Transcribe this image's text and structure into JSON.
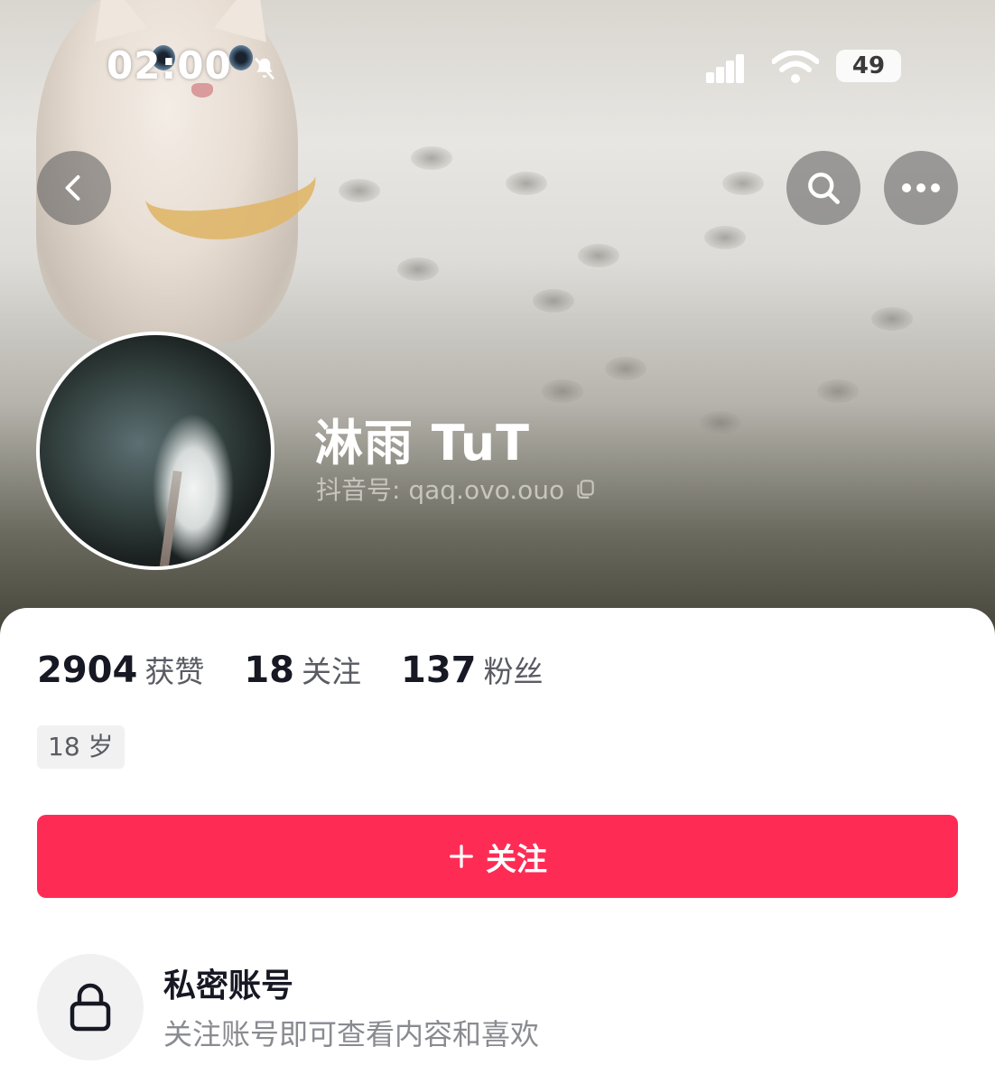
{
  "status_bar": {
    "time": "02:00",
    "battery": "49"
  },
  "profile": {
    "name": "淋雨 TuT",
    "douyin_id": "抖音号: qaq.ovo.ouo"
  },
  "stats": [
    {
      "value": "2904",
      "label": "获赞"
    },
    {
      "value": "18",
      "label": "关注"
    },
    {
      "value": "137",
      "label": "粉丝"
    }
  ],
  "age_tag": "18 岁",
  "follow_button": {
    "icon": "plus-icon",
    "label": "关注"
  },
  "private_account": {
    "icon": "lock-icon",
    "title": "私密账号",
    "description": "关注账号即可查看内容和喜欢"
  },
  "colors": {
    "accent": "#fe2c55",
    "text_primary": "#161823",
    "text_secondary": "#8a8b91"
  }
}
